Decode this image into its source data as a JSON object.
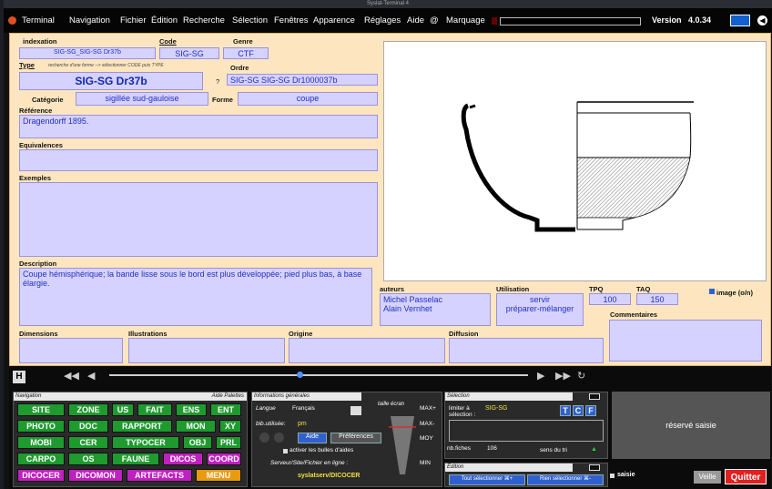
{
  "window": {
    "title": "Syslat-Terminal 4"
  },
  "menu": {
    "items": [
      "Terminal",
      "Navigation",
      "Fichier",
      "Édition",
      "Recherche",
      "Sélection",
      "Fenêtres",
      "Apparence",
      "Réglages",
      "Aide",
      "@",
      "Marquage"
    ],
    "version_label": "Version",
    "version": "4.0.34"
  },
  "form": {
    "indexation_label": "indexation",
    "indexation": "SIG-SG_SIG-SG Dr37b",
    "code_label": "Code",
    "code": "SIG-SG",
    "genre_label": "Genre",
    "genre": "CTF",
    "type_label": "Type",
    "type_hint": "recherche d'une forme --> sélectionner CODE puis TYPE",
    "type": "SIG-SG Dr37b",
    "q_mark": "?",
    "ordre_label": "Ordre",
    "ordre": "SIG-SG  SIG-SG Dr1000037b",
    "categorie_label": "Catégorie",
    "categorie": "sigillée sud-gauloise",
    "forme_label": "Forme",
    "forme": "coupe",
    "reference_label": "Référence",
    "reference": "Dragendorff 1895.",
    "equivalences_label": "Equivalences",
    "equivalences": "",
    "exemples_label": "Exemples",
    "exemples": "",
    "description_label": "Description",
    "description": "Coupe hémisphérique; la bande lisse sous le bord est plus développée; pied plus bas, à base élargie.",
    "auteurs_label": "auteurs",
    "auteurs": [
      "Michel Passelac",
      "Alain Vernhet"
    ],
    "utilisation_label": "Utilisation",
    "utilisation": [
      "servir",
      "préparer-mélanger"
    ],
    "tpq_label": "TPQ",
    "tpq": "100",
    "taq_label": "TAQ",
    "taq": "150",
    "image_label": "image (o/n)",
    "commentaires_label": "Commentaires",
    "dimensions_label": "Dimensions",
    "illustrations_label": "Illustrations",
    "origine_label": "Origine",
    "diffusion_label": "Diffusion"
  },
  "navigation": {
    "title": "Navigation",
    "palettes": "Aide Palettes",
    "rows": [
      [
        {
          "t": "SITE",
          "c": "g"
        },
        {
          "t": "ZONE",
          "c": "g"
        },
        {
          "t": "US",
          "c": "g"
        },
        {
          "t": "FAIT",
          "c": "g"
        },
        {
          "t": "ENS",
          "c": "g"
        },
        {
          "t": "ENT",
          "c": "g"
        }
      ],
      [
        {
          "t": "PHOTO",
          "c": "g"
        },
        {
          "t": "DOC",
          "c": "g"
        },
        {
          "t": "RAPPORT",
          "c": "g"
        },
        {
          "t": "MON",
          "c": "g"
        },
        {
          "t": "XY",
          "c": "g"
        }
      ],
      [
        {
          "t": "MOBI",
          "c": "g"
        },
        {
          "t": "CER",
          "c": "g"
        },
        {
          "t": "TYPOCER",
          "c": "g"
        },
        {
          "t": "OBJ",
          "c": "g"
        },
        {
          "t": "PRL",
          "c": "g"
        }
      ],
      [
        {
          "t": "CARPO",
          "c": "g"
        },
        {
          "t": "OS",
          "c": "g"
        },
        {
          "t": "FAUNE",
          "c": "g"
        },
        {
          "t": "DICOS",
          "c": "m"
        },
        {
          "t": "COORD",
          "c": "m"
        }
      ],
      [
        {
          "t": "DICOCER",
          "c": "m"
        },
        {
          "t": "DICOMON",
          "c": "m"
        },
        {
          "t": "ARTEFACTS",
          "c": "m"
        },
        {
          "t": "MENU",
          "c": "o"
        }
      ]
    ]
  },
  "infos": {
    "title": "Informations générales",
    "langue_label": "Langue",
    "langue": "Français",
    "bib_label": "bib.utilisée:",
    "bib": "pm",
    "taille_label": "taille écran",
    "aide": "Aide",
    "preferences": "Préférences",
    "bulles": "activer les bulles d'aides",
    "serveur_label": "Serveur/Site/Fichier en ligne :",
    "serveur": "syslatserv/DICOCER",
    "sizes": [
      "MAX+",
      "MAX-",
      "MOY",
      "MIN"
    ]
  },
  "selection": {
    "title": "Sélection",
    "limiter": "limiter à",
    "selection_colon": "sélection :",
    "limiter_value": "SIG-SG",
    "tcf": [
      "T",
      "C",
      "F"
    ],
    "nbfiches_label": "nb.fiches",
    "nbfiches": "106",
    "sens": "sens du tri"
  },
  "edition": {
    "title": "Édition",
    "tout": "Tout sélectionner ⌘+",
    "rien": "Rien sélectionner ⌘-"
  },
  "right": {
    "reserve": "réservé saisie",
    "saisie": "saisie",
    "veille": "Veille",
    "quitter": "Quitter"
  },
  "colors": {
    "form_bg": "#fde6bf",
    "field": "#d6d2ff",
    "nav_green": "#1f9a2f",
    "nav_magenta": "#c020c0",
    "quit": "#e02020"
  }
}
